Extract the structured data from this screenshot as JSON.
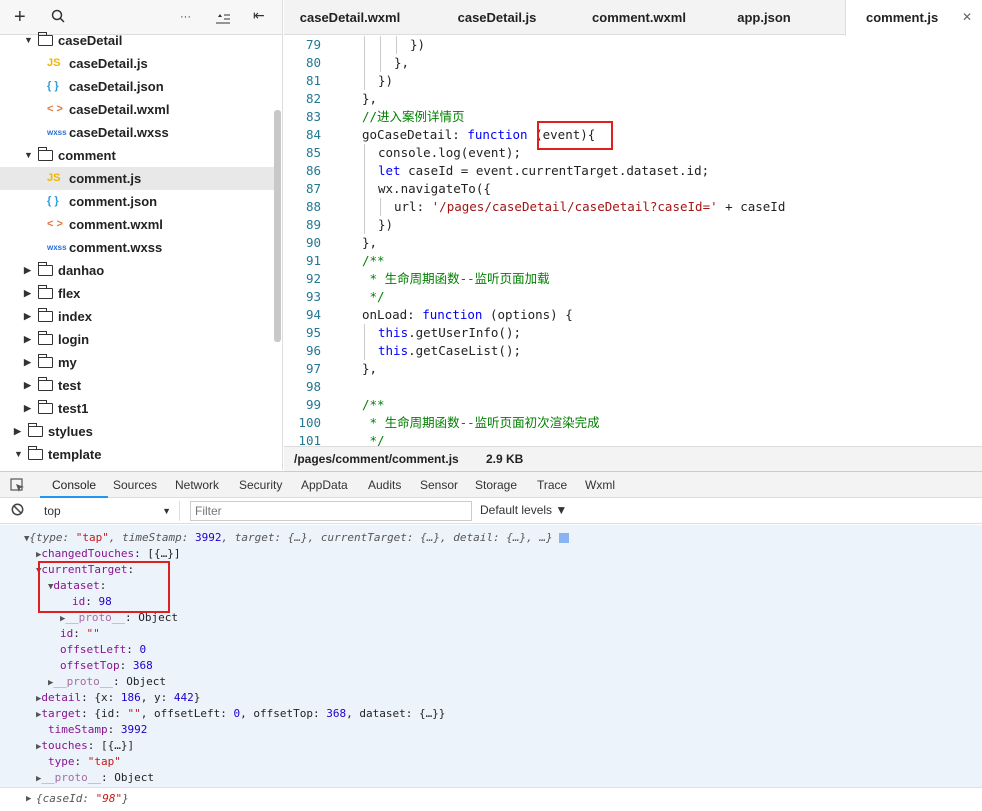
{
  "sidebar": {
    "toolbar": {
      "add": "+",
      "search": "⚲",
      "more": "···",
      "collapse": "⇤"
    },
    "tree": [
      {
        "label": "caseDetail",
        "type": "folder",
        "level": 1,
        "open": true
      },
      {
        "label": "caseDetail.js",
        "type": "js",
        "level": 2
      },
      {
        "label": "caseDetail.json",
        "type": "json",
        "level": 2
      },
      {
        "label": "caseDetail.wxml",
        "type": "wxml",
        "level": 2
      },
      {
        "label": "caseDetail.wxss",
        "type": "wxss",
        "level": 2
      },
      {
        "label": "comment",
        "type": "folder",
        "level": 1,
        "open": true
      },
      {
        "label": "comment.js",
        "type": "js",
        "level": 2,
        "selected": true
      },
      {
        "label": "comment.json",
        "type": "json",
        "level": 2
      },
      {
        "label": "comment.wxml",
        "type": "wxml",
        "level": 2
      },
      {
        "label": "comment.wxss",
        "type": "wxss",
        "level": 2
      },
      {
        "label": "danhao",
        "type": "folder",
        "level": 1,
        "open": false
      },
      {
        "label": "flex",
        "type": "folder",
        "level": 1,
        "open": false
      },
      {
        "label": "index",
        "type": "folder",
        "level": 1,
        "open": false
      },
      {
        "label": "login",
        "type": "folder",
        "level": 1,
        "open": false
      },
      {
        "label": "my",
        "type": "folder",
        "level": 1,
        "open": false
      },
      {
        "label": "test",
        "type": "folder",
        "level": 1,
        "open": false
      },
      {
        "label": "test1",
        "type": "folder",
        "level": 1,
        "open": false
      },
      {
        "label": "stylues",
        "type": "folder",
        "level": 0,
        "open": false
      },
      {
        "label": "template",
        "type": "folder",
        "level": 0,
        "open": true
      }
    ],
    "icon_text": {
      "js": "JS",
      "json": "{ }",
      "wxml": "< >",
      "wxss": "wxss"
    },
    "icon_colors": {
      "js": "#f0b400",
      "json": "#2a9fd6",
      "wxml": "#e8743b",
      "wxss": "#2a6fd6"
    }
  },
  "tabs": [
    {
      "label": "caseDetail.wxml"
    },
    {
      "label": "caseDetail.js"
    },
    {
      "label": "comment.wxml"
    },
    {
      "label": "app.json"
    },
    {
      "label": "comment.js",
      "active": true,
      "close": "✕"
    }
  ],
  "editor": {
    "lines": [
      {
        "n": "79",
        "i": 4,
        "t": [
          [
            "})",
            "p"
          ]
        ]
      },
      {
        "n": "80",
        "i": 3,
        "t": [
          [
            "},",
            "p"
          ]
        ]
      },
      {
        "n": "81",
        "i": 2,
        "t": [
          [
            "})",
            "p"
          ]
        ]
      },
      {
        "n": "82",
        "i": 1,
        "t": [
          [
            "},",
            "p"
          ]
        ]
      },
      {
        "n": "83",
        "i": 1,
        "t": [
          [
            "//进入案例详情页",
            "c"
          ]
        ]
      },
      {
        "n": "84",
        "i": 1,
        "t": [
          [
            "goCaseDetail: ",
            "p"
          ],
          [
            "function",
            "k"
          ],
          [
            " (event){",
            "p"
          ]
        ]
      },
      {
        "n": "85",
        "i": 2,
        "t": [
          [
            "console.log(event);",
            "p"
          ]
        ]
      },
      {
        "n": "86",
        "i": 2,
        "t": [
          [
            "let",
            "k"
          ],
          [
            " caseId = event.currentTarget.dataset.id;",
            "p"
          ]
        ]
      },
      {
        "n": "87",
        "i": 2,
        "t": [
          [
            "wx.navigateTo({",
            "p"
          ]
        ]
      },
      {
        "n": "88",
        "i": 3,
        "t": [
          [
            "url: ",
            "p"
          ],
          [
            "'/pages/caseDetail/caseDetail?caseId='",
            "s"
          ],
          [
            " + caseId",
            "p"
          ]
        ]
      },
      {
        "n": "89",
        "i": 2,
        "t": [
          [
            "})",
            "p"
          ]
        ]
      },
      {
        "n": "90",
        "i": 1,
        "t": [
          [
            "},",
            "p"
          ]
        ]
      },
      {
        "n": "91",
        "i": 1,
        "t": [
          [
            "/**",
            "c"
          ]
        ]
      },
      {
        "n": "92",
        "i": 1,
        "t": [
          [
            " * 生命周期函数--监听页面加载",
            "c"
          ]
        ]
      },
      {
        "n": "93",
        "i": 1,
        "t": [
          [
            " */",
            "c"
          ]
        ]
      },
      {
        "n": "94",
        "i": 1,
        "t": [
          [
            "onLoad: ",
            "p"
          ],
          [
            "function",
            "k"
          ],
          [
            " (options) {",
            "p"
          ]
        ]
      },
      {
        "n": "95",
        "i": 2,
        "t": [
          [
            "this",
            "k"
          ],
          [
            ".getUserInfo();",
            "p"
          ]
        ]
      },
      {
        "n": "96",
        "i": 2,
        "t": [
          [
            "this",
            "k"
          ],
          [
            ".getCaseList();",
            "p"
          ]
        ]
      },
      {
        "n": "97",
        "i": 1,
        "t": [
          [
            "},",
            "p"
          ]
        ]
      },
      {
        "n": "98",
        "i": 1,
        "t": [
          [
            "",
            "p"
          ]
        ]
      },
      {
        "n": "99",
        "i": 1,
        "t": [
          [
            "/**",
            "c"
          ]
        ]
      },
      {
        "n": "100",
        "i": 1,
        "t": [
          [
            " * 生命周期函数--监听页面初次渲染完成",
            "c"
          ]
        ]
      },
      {
        "n": "101",
        "i": 1,
        "t": [
          [
            " */",
            "c"
          ]
        ]
      }
    ]
  },
  "status": {
    "path": "/pages/comment/comment.js",
    "size": "2.9 KB"
  },
  "devtools": {
    "tabs": [
      "Console",
      "Sources",
      "Network",
      "Security",
      "AppData",
      "Audits",
      "Sensor",
      "Storage",
      "Trace",
      "Wxml"
    ],
    "active_tab": "Console",
    "context": "top",
    "filter_placeholder": "Filter",
    "levels": "Default levels ▼"
  },
  "console": {
    "lines": [
      {
        "x": 24,
        "arrow": "▼",
        "t": [
          [
            "{type: ",
            "it"
          ],
          [
            "\"tap\"",
            "str"
          ],
          [
            ", timeStamp: ",
            "it"
          ],
          [
            "3992",
            "num"
          ],
          [
            ", target: {…}, currentTarget: {…}, detail: {…}, …}",
            "it"
          ]
        ]
      },
      {
        "x": 36,
        "arrow": "▶",
        "t": [
          [
            "changedTouches",
            "key"
          ],
          [
            ": [{…}]",
            "p"
          ]
        ]
      },
      {
        "x": 36,
        "arrow": "▼",
        "t": [
          [
            "currentTarget",
            "key"
          ],
          [
            ":",
            "p"
          ]
        ]
      },
      {
        "x": 48,
        "arrow": "▼",
        "t": [
          [
            "dataset",
            "key"
          ],
          [
            ":",
            "p"
          ]
        ]
      },
      {
        "x": 72,
        "arrow": "",
        "t": [
          [
            "id",
            "key"
          ],
          [
            ": ",
            "p"
          ],
          [
            "98",
            "num"
          ]
        ]
      },
      {
        "x": 60,
        "arrow": "▶",
        "t": [
          [
            "__proto__",
            "dim"
          ],
          [
            ": Object",
            "p"
          ]
        ]
      },
      {
        "x": 60,
        "arrow": "",
        "t": [
          [
            "id",
            "key"
          ],
          [
            ": ",
            "p"
          ],
          [
            "\"\"",
            "str"
          ]
        ]
      },
      {
        "x": 60,
        "arrow": "",
        "t": [
          [
            "offsetLeft",
            "key"
          ],
          [
            ": ",
            "p"
          ],
          [
            "0",
            "num"
          ]
        ]
      },
      {
        "x": 60,
        "arrow": "",
        "t": [
          [
            "offsetTop",
            "key"
          ],
          [
            ": ",
            "p"
          ],
          [
            "368",
            "num"
          ]
        ]
      },
      {
        "x": 48,
        "arrow": "▶",
        "t": [
          [
            "__proto__",
            "dim"
          ],
          [
            ": Object",
            "p"
          ]
        ]
      },
      {
        "x": 36,
        "arrow": "▶",
        "t": [
          [
            "detail",
            "key"
          ],
          [
            ": {x: ",
            "p"
          ],
          [
            "186",
            "num"
          ],
          [
            ", y: ",
            "p"
          ],
          [
            "442",
            "num"
          ],
          [
            "}",
            "p"
          ]
        ]
      },
      {
        "x": 36,
        "arrow": "▶",
        "t": [
          [
            "target",
            "key"
          ],
          [
            ": {id: ",
            "p"
          ],
          [
            "\"\"",
            "str"
          ],
          [
            ", offsetLeft: ",
            "p"
          ],
          [
            "0",
            "num"
          ],
          [
            ", offsetTop: ",
            "p"
          ],
          [
            "368",
            "num"
          ],
          [
            ", dataset: {…}}",
            "p"
          ]
        ]
      },
      {
        "x": 48,
        "arrow": "",
        "t": [
          [
            "timeStamp",
            "key"
          ],
          [
            ": ",
            "p"
          ],
          [
            "3992",
            "num"
          ]
        ]
      },
      {
        "x": 36,
        "arrow": "▶",
        "t": [
          [
            "touches",
            "key"
          ],
          [
            ": [{…}]",
            "p"
          ]
        ]
      },
      {
        "x": 48,
        "arrow": "",
        "t": [
          [
            "type",
            "key"
          ],
          [
            ": ",
            "p"
          ],
          [
            "\"tap\"",
            "str"
          ]
        ]
      },
      {
        "x": 36,
        "arrow": "▶",
        "t": [
          [
            "__proto__",
            "dim"
          ],
          [
            ": Object",
            "p"
          ]
        ]
      }
    ],
    "last": [
      [
        "{caseId: ",
        "it"
      ],
      [
        "\"98\"",
        "str"
      ],
      [
        "}",
        "it"
      ]
    ]
  }
}
